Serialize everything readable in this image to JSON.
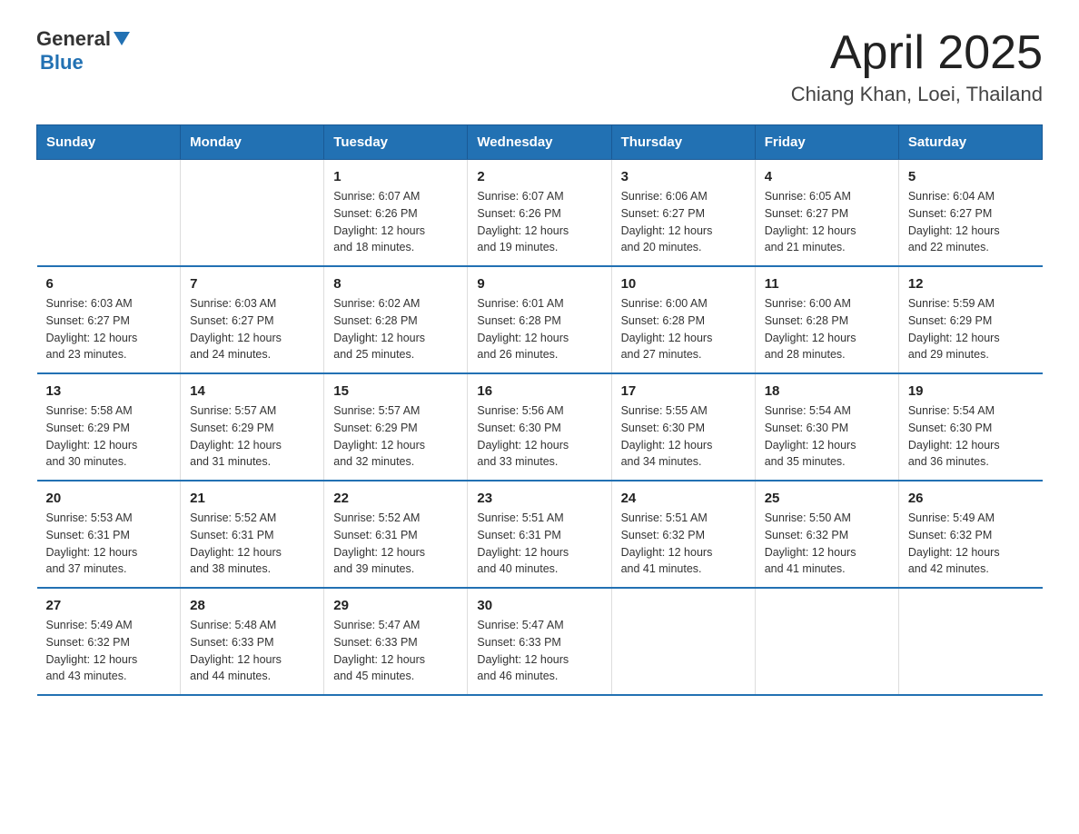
{
  "header": {
    "logo_general": "General",
    "logo_blue": "Blue",
    "title": "April 2025",
    "subtitle": "Chiang Khan, Loei, Thailand"
  },
  "calendar": {
    "headers": [
      "Sunday",
      "Monday",
      "Tuesday",
      "Wednesday",
      "Thursday",
      "Friday",
      "Saturday"
    ],
    "weeks": [
      [
        {
          "day": "",
          "info": ""
        },
        {
          "day": "",
          "info": ""
        },
        {
          "day": "1",
          "info": "Sunrise: 6:07 AM\nSunset: 6:26 PM\nDaylight: 12 hours\nand 18 minutes."
        },
        {
          "day": "2",
          "info": "Sunrise: 6:07 AM\nSunset: 6:26 PM\nDaylight: 12 hours\nand 19 minutes."
        },
        {
          "day": "3",
          "info": "Sunrise: 6:06 AM\nSunset: 6:27 PM\nDaylight: 12 hours\nand 20 minutes."
        },
        {
          "day": "4",
          "info": "Sunrise: 6:05 AM\nSunset: 6:27 PM\nDaylight: 12 hours\nand 21 minutes."
        },
        {
          "day": "5",
          "info": "Sunrise: 6:04 AM\nSunset: 6:27 PM\nDaylight: 12 hours\nand 22 minutes."
        }
      ],
      [
        {
          "day": "6",
          "info": "Sunrise: 6:03 AM\nSunset: 6:27 PM\nDaylight: 12 hours\nand 23 minutes."
        },
        {
          "day": "7",
          "info": "Sunrise: 6:03 AM\nSunset: 6:27 PM\nDaylight: 12 hours\nand 24 minutes."
        },
        {
          "day": "8",
          "info": "Sunrise: 6:02 AM\nSunset: 6:28 PM\nDaylight: 12 hours\nand 25 minutes."
        },
        {
          "day": "9",
          "info": "Sunrise: 6:01 AM\nSunset: 6:28 PM\nDaylight: 12 hours\nand 26 minutes."
        },
        {
          "day": "10",
          "info": "Sunrise: 6:00 AM\nSunset: 6:28 PM\nDaylight: 12 hours\nand 27 minutes."
        },
        {
          "day": "11",
          "info": "Sunrise: 6:00 AM\nSunset: 6:28 PM\nDaylight: 12 hours\nand 28 minutes."
        },
        {
          "day": "12",
          "info": "Sunrise: 5:59 AM\nSunset: 6:29 PM\nDaylight: 12 hours\nand 29 minutes."
        }
      ],
      [
        {
          "day": "13",
          "info": "Sunrise: 5:58 AM\nSunset: 6:29 PM\nDaylight: 12 hours\nand 30 minutes."
        },
        {
          "day": "14",
          "info": "Sunrise: 5:57 AM\nSunset: 6:29 PM\nDaylight: 12 hours\nand 31 minutes."
        },
        {
          "day": "15",
          "info": "Sunrise: 5:57 AM\nSunset: 6:29 PM\nDaylight: 12 hours\nand 32 minutes."
        },
        {
          "day": "16",
          "info": "Sunrise: 5:56 AM\nSunset: 6:30 PM\nDaylight: 12 hours\nand 33 minutes."
        },
        {
          "day": "17",
          "info": "Sunrise: 5:55 AM\nSunset: 6:30 PM\nDaylight: 12 hours\nand 34 minutes."
        },
        {
          "day": "18",
          "info": "Sunrise: 5:54 AM\nSunset: 6:30 PM\nDaylight: 12 hours\nand 35 minutes."
        },
        {
          "day": "19",
          "info": "Sunrise: 5:54 AM\nSunset: 6:30 PM\nDaylight: 12 hours\nand 36 minutes."
        }
      ],
      [
        {
          "day": "20",
          "info": "Sunrise: 5:53 AM\nSunset: 6:31 PM\nDaylight: 12 hours\nand 37 minutes."
        },
        {
          "day": "21",
          "info": "Sunrise: 5:52 AM\nSunset: 6:31 PM\nDaylight: 12 hours\nand 38 minutes."
        },
        {
          "day": "22",
          "info": "Sunrise: 5:52 AM\nSunset: 6:31 PM\nDaylight: 12 hours\nand 39 minutes."
        },
        {
          "day": "23",
          "info": "Sunrise: 5:51 AM\nSunset: 6:31 PM\nDaylight: 12 hours\nand 40 minutes."
        },
        {
          "day": "24",
          "info": "Sunrise: 5:51 AM\nSunset: 6:32 PM\nDaylight: 12 hours\nand 41 minutes."
        },
        {
          "day": "25",
          "info": "Sunrise: 5:50 AM\nSunset: 6:32 PM\nDaylight: 12 hours\nand 41 minutes."
        },
        {
          "day": "26",
          "info": "Sunrise: 5:49 AM\nSunset: 6:32 PM\nDaylight: 12 hours\nand 42 minutes."
        }
      ],
      [
        {
          "day": "27",
          "info": "Sunrise: 5:49 AM\nSunset: 6:32 PM\nDaylight: 12 hours\nand 43 minutes."
        },
        {
          "day": "28",
          "info": "Sunrise: 5:48 AM\nSunset: 6:33 PM\nDaylight: 12 hours\nand 44 minutes."
        },
        {
          "day": "29",
          "info": "Sunrise: 5:47 AM\nSunset: 6:33 PM\nDaylight: 12 hours\nand 45 minutes."
        },
        {
          "day": "30",
          "info": "Sunrise: 5:47 AM\nSunset: 6:33 PM\nDaylight: 12 hours\nand 46 minutes."
        },
        {
          "day": "",
          "info": ""
        },
        {
          "day": "",
          "info": ""
        },
        {
          "day": "",
          "info": ""
        }
      ]
    ]
  }
}
